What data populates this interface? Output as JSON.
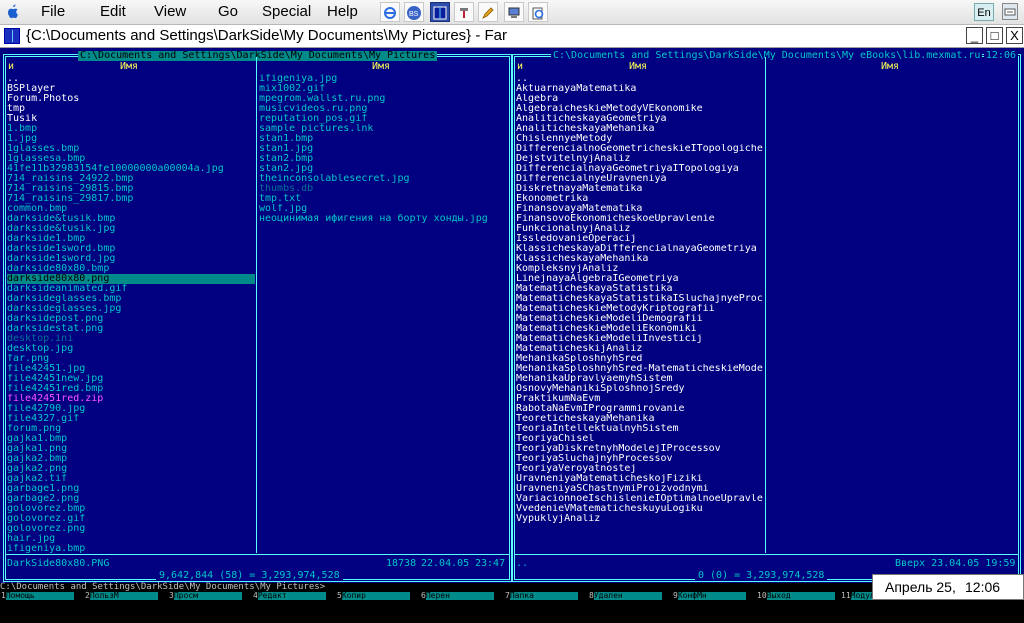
{
  "menubar": {
    "items": [
      "File",
      "Edit",
      "View",
      "Go",
      "Special",
      "Help"
    ],
    "toolbar": [
      "ie-icon",
      "bs-player-icon",
      "far-manager-icon",
      "tools-icon",
      "pencil-icon",
      "computer-icon",
      "ie2-icon"
    ],
    "lang": "En"
  },
  "window": {
    "title": "{C:\\Documents and Settings\\DarkSide\\My Documents\\My Pictures} - Far",
    "btn_min": "_",
    "btn_max": "□",
    "btn_close": "X"
  },
  "left_panel": {
    "path": "C:\\Documents and Settings\\DarkSide\\My Documents\\My Pictures",
    "col_n": "и",
    "col_name": "Имя",
    "col1": [
      {
        "name": "..",
        "type": "dir"
      },
      {
        "name": "BSPlayer",
        "type": "dir"
      },
      {
        "name": "Forum.Photos",
        "type": "dir"
      },
      {
        "name": "tmp",
        "type": "dir"
      },
      {
        "name": "Tusik",
        "type": "dir"
      },
      {
        "name": "1.bmp",
        "type": "file"
      },
      {
        "name": "1.jpg",
        "type": "file"
      },
      {
        "name": "1glasses.bmp",
        "type": "file"
      },
      {
        "name": "1glassesa.bmp",
        "type": "file"
      },
      {
        "name": "41fe11b32983154fe10000000a00004a.jpg",
        "type": "file"
      },
      {
        "name": "714_raisins_24922.bmp",
        "type": "file"
      },
      {
        "name": "714_raisins_29815.bmp",
        "type": "file"
      },
      {
        "name": "714_raisins_29817.bmp",
        "type": "file"
      },
      {
        "name": "common.bmp",
        "type": "file"
      },
      {
        "name": "darkside&tusik.bmp",
        "type": "file"
      },
      {
        "name": "darkside&tusik.jpg",
        "type": "file"
      },
      {
        "name": "darkside1.bmp",
        "type": "file"
      },
      {
        "name": "darkside1sword.bmp",
        "type": "file"
      },
      {
        "name": "darkside1sword.jpg",
        "type": "file"
      },
      {
        "name": "darkside80x80.bmp",
        "type": "file"
      },
      {
        "name": "darkside80x80.png",
        "type": "cursor"
      },
      {
        "name": "darksideanimated.gif",
        "type": "file"
      },
      {
        "name": "darksideglasses.bmp",
        "type": "file"
      },
      {
        "name": "darksideglasses.jpg",
        "type": "file"
      },
      {
        "name": "darksidepost.png",
        "type": "file"
      },
      {
        "name": "darksidestat.png",
        "type": "file"
      },
      {
        "name": "desktop.ini",
        "type": "hidden"
      },
      {
        "name": "desktop.jpg",
        "type": "file"
      },
      {
        "name": "far.png",
        "type": "file"
      },
      {
        "name": "file42451.jpg",
        "type": "file"
      },
      {
        "name": "file42451new.jpg",
        "type": "file"
      },
      {
        "name": "file42451red.bmp",
        "type": "file"
      },
      {
        "name": "file42451red.zip",
        "type": "archive"
      },
      {
        "name": "file42790.jpg",
        "type": "file"
      },
      {
        "name": "file4327.gif",
        "type": "file"
      },
      {
        "name": "forum.png",
        "type": "file"
      },
      {
        "name": "gajka1.bmp",
        "type": "file"
      },
      {
        "name": "gajka1.png",
        "type": "file"
      },
      {
        "name": "gajka2.bmp",
        "type": "file"
      },
      {
        "name": "gajka2.png",
        "type": "file"
      },
      {
        "name": "gajka2.tif",
        "type": "file"
      },
      {
        "name": "garbage1.png",
        "type": "file"
      },
      {
        "name": "garbage2.png",
        "type": "file"
      },
      {
        "name": "golovorez.bmp",
        "type": "file"
      },
      {
        "name": "golovorez.gif",
        "type": "file"
      },
      {
        "name": "golovorez.png",
        "type": "file"
      },
      {
        "name": "hair.jpg",
        "type": "file"
      },
      {
        "name": "ifigeniya.bmp",
        "type": "file"
      }
    ],
    "col2": [
      {
        "name": "ifigeniya.jpg",
        "type": "file"
      },
      {
        "name": "mix1002.gif",
        "type": "file"
      },
      {
        "name": "mpegrom.wallst.ru.png",
        "type": "file"
      },
      {
        "name": "musicvideos.ru.png",
        "type": "file"
      },
      {
        "name": "reputation_pos.gif",
        "type": "file"
      },
      {
        "name": "sample pictures.lnk",
        "type": "file"
      },
      {
        "name": "stan1.bmp",
        "type": "file"
      },
      {
        "name": "stan1.jpg",
        "type": "file"
      },
      {
        "name": "stan2.bmp",
        "type": "file"
      },
      {
        "name": "stan2.jpg",
        "type": "file"
      },
      {
        "name": "theinconsolablesecret.jpg",
        "type": "file"
      },
      {
        "name": "thumbs.db",
        "type": "hidden"
      },
      {
        "name": "tmp.txt",
        "type": "file"
      },
      {
        "name": "wolf.jpg",
        "type": "file"
      },
      {
        "name": "неоцинимая ифигения на борту хонды.jpg",
        "type": "file"
      }
    ],
    "status_name": "DarkSide80x80.PNG",
    "status_size": "18738",
    "status_date": "22.04.05",
    "status_time": "23:47",
    "totals": "9,642,844 (58) = 3,293,974,528"
  },
  "right_panel": {
    "path": "C:\\Documents and Settings\\DarkSide\\My Documents\\My eBooks\\lib.mexmat.ru",
    "clock": "12:06",
    "col_n": "и",
    "col_name": "Имя",
    "col1": [
      {
        "name": "..",
        "type": "dir"
      },
      {
        "name": "AktuarnayaMatematika",
        "type": "dir"
      },
      {
        "name": "Algebra",
        "type": "dir"
      },
      {
        "name": "AlgebraicheskieMetodyVEkonomike",
        "type": "dir"
      },
      {
        "name": "AnaliticheskayaGeometriya",
        "type": "dir"
      },
      {
        "name": "AnaliticheskayaMehanika",
        "type": "dir"
      },
      {
        "name": "ChislennyeMetody",
        "type": "dir"
      },
      {
        "name": "DifferencialnoGeometricheskieITopologiche}",
        "type": "dir"
      },
      {
        "name": "DejstvitelnyjAnaliz",
        "type": "dir"
      },
      {
        "name": "DifferencialnayaGeometriyaITopologiya",
        "type": "dir"
      },
      {
        "name": "DifferencialnyeUravneniya",
        "type": "dir"
      },
      {
        "name": "DiskretnayaMatematika",
        "type": "dir"
      },
      {
        "name": "Ekonometrika",
        "type": "dir"
      },
      {
        "name": "FinansovayaMatematika",
        "type": "dir"
      },
      {
        "name": "FinansovoEkonomicheskoeUpravlenie",
        "type": "dir"
      },
      {
        "name": "FunkcionalnyjAnaliz",
        "type": "dir"
      },
      {
        "name": "IssledovanieOperacij",
        "type": "dir"
      },
      {
        "name": "KlassicheskayaDifferencialnayaGeometriya",
        "type": "dir"
      },
      {
        "name": "KlassicheskayaMehanika",
        "type": "dir"
      },
      {
        "name": "KompleksnyjAnaliz",
        "type": "dir"
      },
      {
        "name": "LinejnayaAlgebraIGeometriya",
        "type": "dir"
      },
      {
        "name": "MatematicheskayaStatistika",
        "type": "dir"
      },
      {
        "name": "MatematicheskayaStatistikaISluchajnyeProc}",
        "type": "dir"
      },
      {
        "name": "MatematicheskieMetodyKriptografii",
        "type": "dir"
      },
      {
        "name": "MatematicheskieModeliDemografii",
        "type": "dir"
      },
      {
        "name": "MatematicheskieModeliEkonomiki",
        "type": "dir"
      },
      {
        "name": "MatematicheskieModeliInvesticij",
        "type": "dir"
      },
      {
        "name": "MatematicheskijAnaliz",
        "type": "dir"
      },
      {
        "name": "MehanikaSploshnyhSred",
        "type": "dir"
      },
      {
        "name": "MehanikaSploshnyhSred-MatematicheskieMode}",
        "type": "dir"
      },
      {
        "name": "MehanikaUpravlyaemyhSistem",
        "type": "dir"
      },
      {
        "name": "OsnovyMehanikiSploshnojSredy",
        "type": "dir"
      },
      {
        "name": "PraktikumNaEvm",
        "type": "dir"
      },
      {
        "name": "RabotaNaEvmIProgrammirovanie",
        "type": "dir"
      },
      {
        "name": "TeoreticheskayaMehanika",
        "type": "dir"
      },
      {
        "name": "TeoriaIntellektualnyhSistem",
        "type": "dir"
      },
      {
        "name": "TeoriyaChisel",
        "type": "dir"
      },
      {
        "name": "TeoriyaDiskretnyhModelejIProcessov",
        "type": "dir"
      },
      {
        "name": "TeoriyaSluchajnyhProcessov",
        "type": "dir"
      },
      {
        "name": "TeoriyaVeroyatnostej",
        "type": "dir"
      },
      {
        "name": "UravneniyaMatematicheskojFiziki",
        "type": "dir"
      },
      {
        "name": "UravneniyaSChastnymiProizvodnymi",
        "type": "dir"
      },
      {
        "name": "VariacionnoeIschislenieIOptimalnoeUpravle}",
        "type": "dir"
      },
      {
        "name": "VvedenieVMatematicheskuyuLogiku",
        "type": "dir"
      },
      {
        "name": "VypuklyjAnaliz",
        "type": "dir"
      }
    ],
    "status_left": "..",
    "status_right": "Вверх 23.04.05 19:59",
    "totals": "0 (0) = 3,293,974,528"
  },
  "command_line": "C:\\Documents and Settings\\DarkSide\\My Documents\\My Pictures>",
  "keybar": [
    {
      "num": "1",
      "label": "Помощь"
    },
    {
      "num": "2",
      "label": "ПользМ"
    },
    {
      "num": "3",
      "label": "Просм"
    },
    {
      "num": "4",
      "label": "Редакт"
    },
    {
      "num": "5",
      "label": "Копир"
    },
    {
      "num": "6",
      "label": "Перен"
    },
    {
      "num": "7",
      "label": "Папка"
    },
    {
      "num": "8",
      "label": "Удален"
    },
    {
      "num": "9",
      "label": "КонфМн"
    },
    {
      "num": "10",
      "label": "Выход"
    },
    {
      "num": "11",
      "label": "Модули"
    }
  ],
  "tray": {
    "date": "Апрель 25,",
    "time": "12:06 pm"
  },
  "colors": {
    "far_bg": "#000080",
    "far_text": "#00c8c8",
    "cursor": "#008a8a",
    "border": "#55ffff"
  }
}
